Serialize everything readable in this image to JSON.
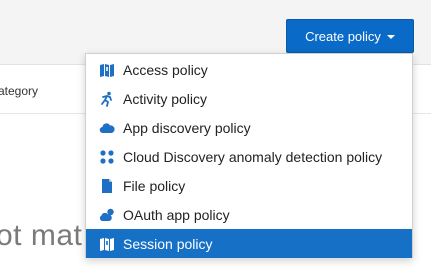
{
  "toolbar": {
    "create_policy_label": "Create policy"
  },
  "table": {
    "column_category": "ategory"
  },
  "empty_state": {
    "text": "ot mat"
  },
  "menu": {
    "items": [
      {
        "label": "Access policy",
        "icon": "access-policy-icon"
      },
      {
        "label": "Activity policy",
        "icon": "activity-policy-icon"
      },
      {
        "label": "App discovery policy",
        "icon": "cloud-icon"
      },
      {
        "label": "Cloud Discovery anomaly detection policy",
        "icon": "anomaly-dots-icon"
      },
      {
        "label": "File policy",
        "icon": "file-icon"
      },
      {
        "label": "OAuth app policy",
        "icon": "oauth-app-icon"
      },
      {
        "label": "Session policy",
        "icon": "session-policy-icon",
        "highlighted": true
      }
    ]
  },
  "colors": {
    "accent": "#0a6ac7",
    "highlight": "#1671c6",
    "icon_blue": "#1f6fc4"
  }
}
